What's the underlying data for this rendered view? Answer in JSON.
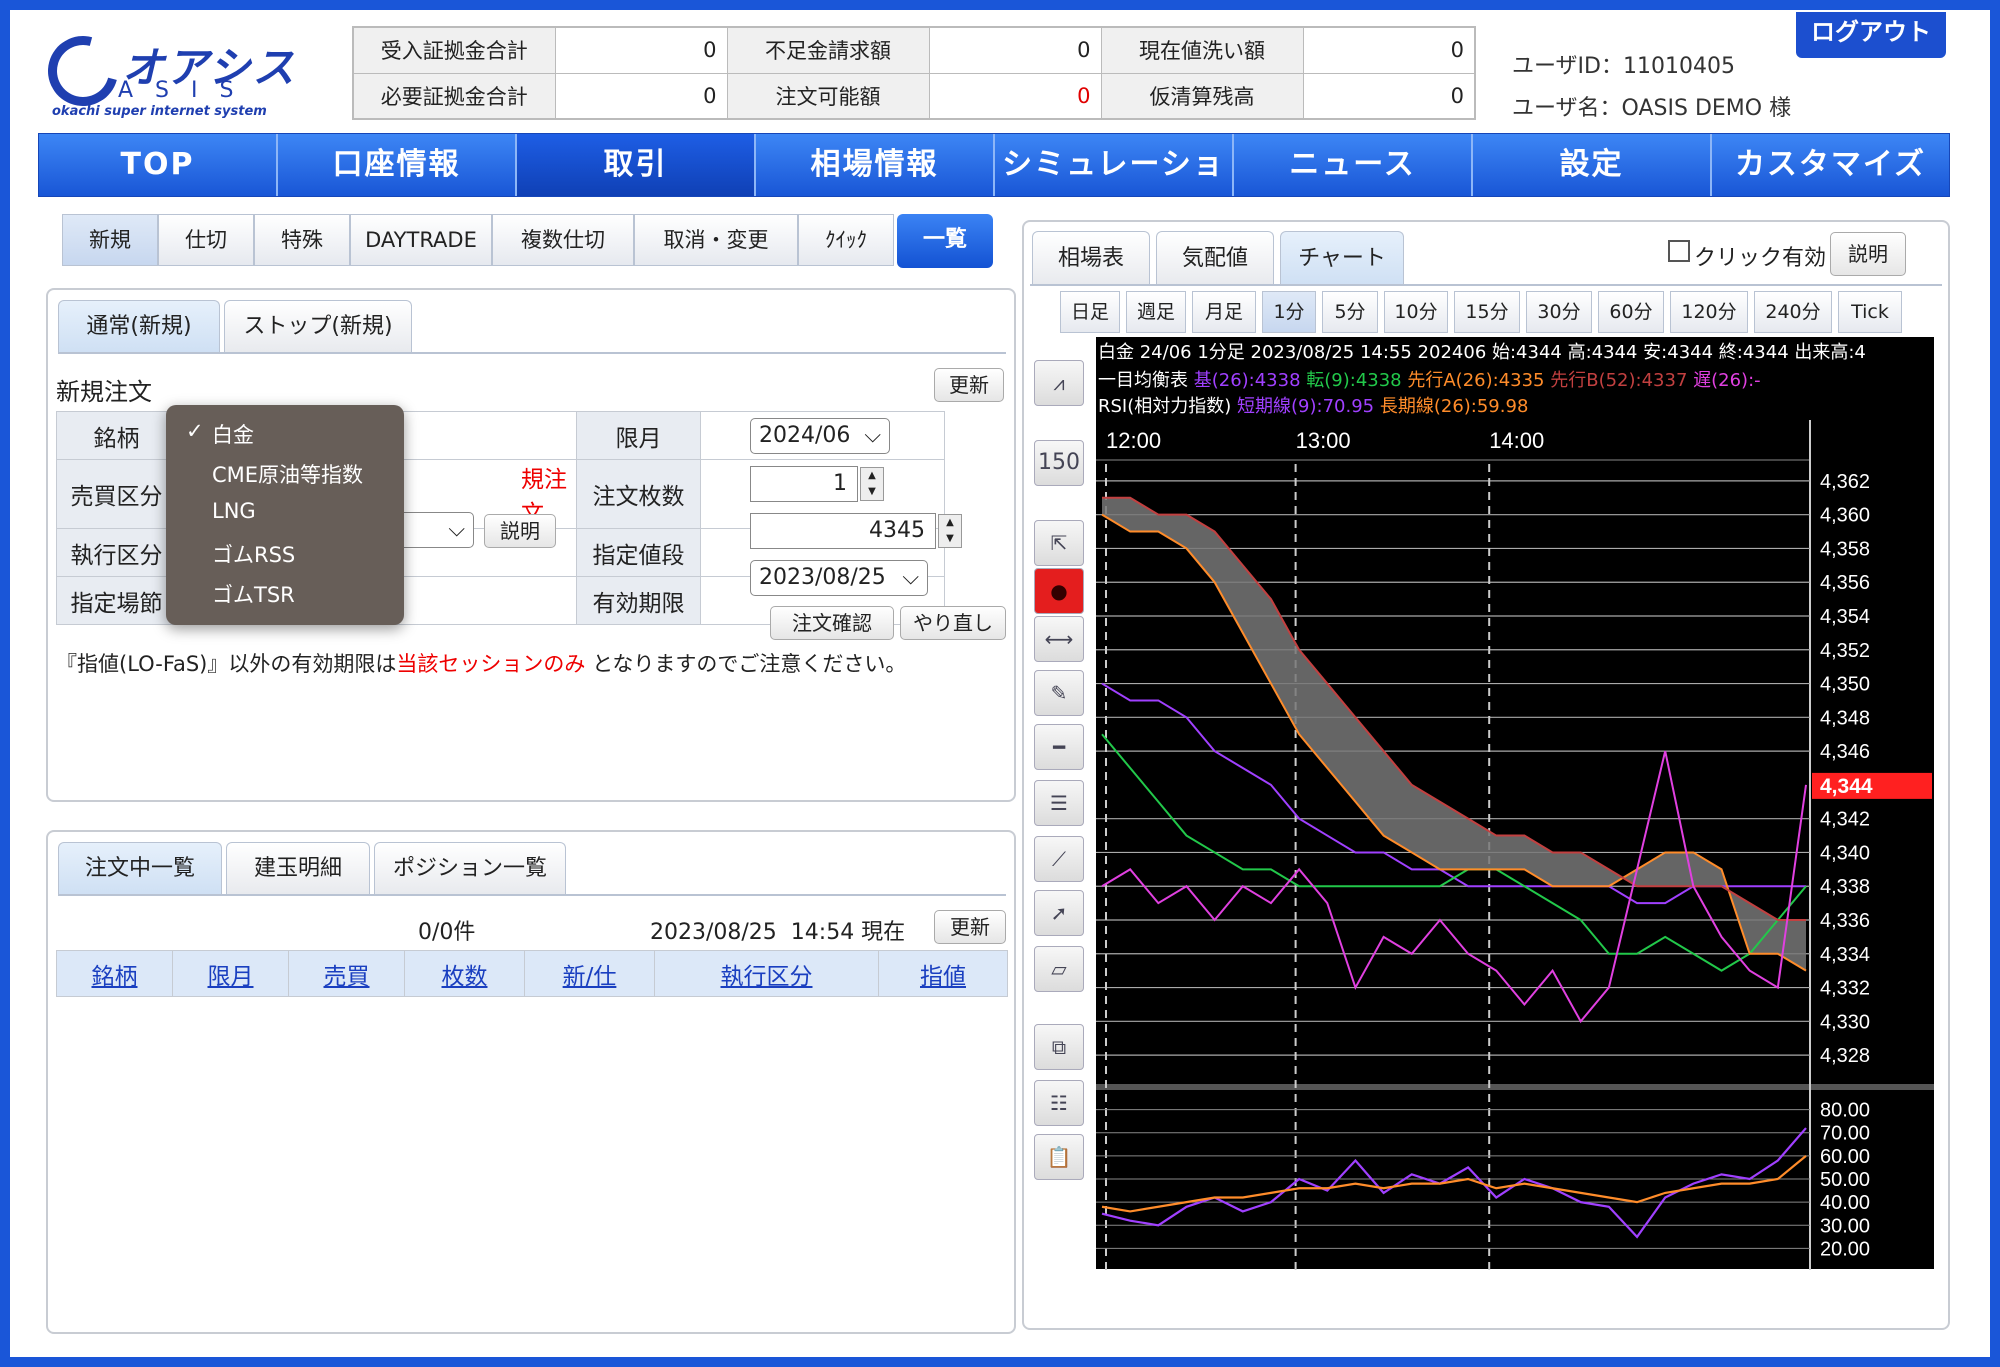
{
  "logo": {
    "text": "オアシス",
    "sub": "ASIS",
    "tagline": "okachi super internet system"
  },
  "summary": {
    "rows": [
      [
        {
          "label": "受入証拠金合計",
          "value": "0"
        },
        {
          "label": "不足金請求額",
          "value": "0"
        },
        {
          "label": "現在値洗い額",
          "value": "0"
        }
      ],
      [
        {
          "label": "必要証拠金合計",
          "value": "0"
        },
        {
          "label": "注文可能額",
          "value": "0",
          "color": "#e00000"
        },
        {
          "label": "仮清算残高",
          "value": "0"
        }
      ]
    ]
  },
  "user": {
    "id": "ユーザID：11010405",
    "name": "ユーザ名：OASIS DEMO 様"
  },
  "logout_label": "ログアウト",
  "nav": [
    "TOP",
    "口座情報",
    "取引",
    "相場情報",
    "シミュレーション",
    "ニュース",
    "設定",
    "カスタマイズ"
  ],
  "nav_active": 2,
  "trade_buttons": [
    "新規",
    "仕切",
    "特殊",
    "DAYTRADE",
    "複数仕切",
    "取消・変更",
    "ｸｲｯｸ"
  ],
  "list_button": "一覧",
  "order_tabs": [
    "通常(新規)",
    "ストップ(新規)"
  ],
  "form": {
    "title": "新規注文",
    "refresh": "更新",
    "labels": {
      "symbol": "銘柄",
      "side": "売買区分",
      "exec": "執行区分",
      "session": "指定場節",
      "month": "限月",
      "qty": "注文枚数",
      "price": "指定値段",
      "expiry": "有効期限"
    },
    "side_value": "規注文",
    "explain": "説明",
    "month_value": "2024/06",
    "qty_value": "1",
    "price_value": "4345",
    "expiry_value": "2023/08/25",
    "confirm": "注文確認",
    "redo": "やり直し"
  },
  "dropdown": {
    "items": [
      "白金",
      "CME原油等指数",
      "LNG",
      "ゴムRSS",
      "ゴムTSR"
    ],
    "selected": 0,
    "check": "✓"
  },
  "note": {
    "pre": "『指値(LO-FaS)』以外の有効期限は",
    "red": "当該セッションのみ",
    "post": " となりますのでご注意ください。"
  },
  "list_tabs": [
    "注文中一覧",
    "建玉明細",
    "ポジション一覧"
  ],
  "list": {
    "count": "0/0件",
    "timestamp": "2023/08/25  14:54 現在",
    "refresh": "更新",
    "columns": [
      "銘柄",
      "限月",
      "売買",
      "枚数",
      "新/仕",
      "執行区分",
      "指値"
    ]
  },
  "right_tabs": [
    "相場表",
    "気配値",
    "チャート"
  ],
  "right_active": 2,
  "click_enable": "クリック有効",
  "right_explain": "説明",
  "periods": [
    "日足",
    "週足",
    "月足",
    "1分",
    "5分",
    "10分",
    "15分",
    "30分",
    "60分",
    "120分",
    "240分",
    "Tick"
  ],
  "period_active": 3,
  "tools": [
    "chart-type-icon",
    "150",
    "cursor-up-icon",
    "drop-icon",
    "arrows-horizontal-icon",
    "pencil-icon",
    "line-icon",
    "lines-icon",
    "fan-icon",
    "arrow-pointer-icon",
    "eraser-icon",
    "copy-icon",
    "people-icon",
    "clipboard-icon"
  ],
  "chart_info": {
    "line1": "白金 24/06 1分足 2023/08/25 14:55 202406 始:4344 高:4344 安:4344 終:4344 出来高:4",
    "line2_label": "一目均衡表",
    "line2": [
      {
        "t": " 基(26):4338",
        "c": "#a040ff"
      },
      {
        "t": " 転(9):4338",
        "c": "#22c84a"
      },
      {
        "t": " 先行A(26):4335",
        "c": "#ff8c2a"
      },
      {
        "t": " 先行B(52):4337",
        "c": "#c24040"
      },
      {
        "t": " 遅(26):-",
        "c": "#e040e0"
      }
    ],
    "line3_label": "RSI(相対力指数)",
    "line3": [
      {
        "t": " 短期線(9):70.95",
        "c": "#a040ff"
      },
      {
        "t": " 長期線(26):59.98",
        "c": "#ff8c2a"
      }
    ]
  },
  "chart_data": {
    "type": "line",
    "title": "白金 24/06 1分足",
    "time_labels": [
      "12:00",
      "13:00",
      "14:00"
    ],
    "yticks": [
      4362,
      4360,
      4358,
      4356,
      4354,
      4352,
      4350,
      4348,
      4346,
      4342,
      4340,
      4338,
      4336,
      4334,
      4332,
      4330,
      4328
    ],
    "ylim": [
      4327,
      4363
    ],
    "current_price": "4,344",
    "rsi_ticks": [
      "80.00",
      "70.00",
      "60.00",
      "50.00",
      "40.00",
      "30.00",
      "20.00"
    ],
    "rsi_ylim": [
      15,
      85
    ],
    "series": [
      {
        "name": "基(26)",
        "color": "#a040ff",
        "values": [
          4350,
          4349,
          4349,
          4348,
          4346,
          4345,
          4344,
          4342,
          4341,
          4340,
          4340,
          4339,
          4339,
          4338,
          4338,
          4338,
          4338,
          4338,
          4338,
          4337,
          4337,
          4338,
          4338,
          4338,
          4338,
          4338
        ]
      },
      {
        "name": "転(9)",
        "color": "#22c84a",
        "values": [
          4347,
          4345,
          4343,
          4341,
          4340,
          4339,
          4339,
          4338,
          4338,
          4338,
          4338,
          4338,
          4338,
          4339,
          4339,
          4338,
          4337,
          4336,
          4334,
          4334,
          4335,
          4334,
          4333,
          4334,
          4336,
          4338
        ]
      },
      {
        "name": "先行A(26)",
        "color": "#ff8c2a",
        "values": [
          4360,
          4359,
          4359,
          4358,
          4356,
          4353,
          4350,
          4347,
          4345,
          4343,
          4341,
          4340,
          4339,
          4339,
          4339,
          4339,
          4338,
          4338,
          4338,
          4339,
          4340,
          4340,
          4339,
          4334,
          4334,
          4333
        ]
      },
      {
        "name": "先行B(52)",
        "color": "#c24040",
        "values": [
          4361,
          4361,
          4360,
          4360,
          4359,
          4357,
          4355,
          4352,
          4350,
          4348,
          4346,
          4344,
          4343,
          4342,
          4341,
          4341,
          4340,
          4340,
          4339,
          4338,
          4338,
          4338,
          4338,
          4337,
          4336,
          4336
        ]
      },
      {
        "name": "遅(26)",
        "color": "#e040e0",
        "values": [
          4338,
          4339,
          4337,
          4338,
          4336,
          4338,
          4337,
          4339,
          4337,
          4332,
          4335,
          4334,
          4336,
          4334,
          4333,
          4331,
          4333,
          4330,
          4332,
          4339,
          4346,
          4338,
          4335,
          4333,
          4332,
          4344
        ]
      }
    ],
    "rsi": [
      {
        "name": "短期線(9)",
        "color": "#a040ff",
        "values": [
          35,
          32,
          30,
          38,
          42,
          36,
          40,
          50,
          45,
          58,
          44,
          52,
          48,
          55,
          42,
          50,
          46,
          40,
          38,
          25,
          42,
          48,
          52,
          50,
          58,
          72
        ]
      },
      {
        "name": "長期線(26)",
        "color": "#ff8c2a",
        "values": [
          38,
          36,
          38,
          40,
          42,
          42,
          44,
          46,
          46,
          48,
          46,
          48,
          48,
          50,
          46,
          48,
          46,
          44,
          42,
          40,
          44,
          46,
          48,
          48,
          50,
          60
        ]
      }
    ]
  }
}
